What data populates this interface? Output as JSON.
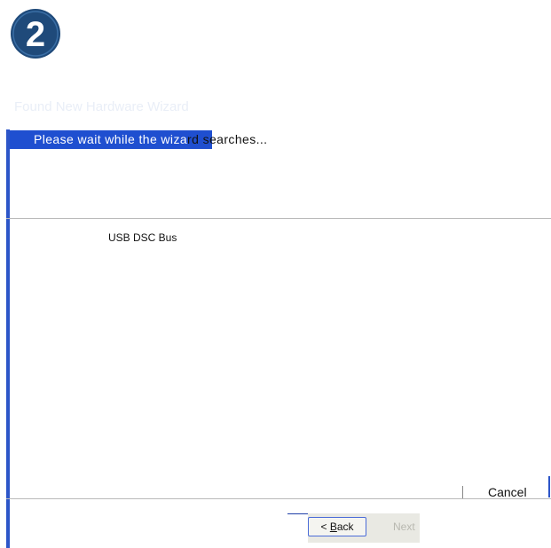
{
  "step": {
    "number": "2",
    "color": "#1f4a7a"
  },
  "wizard": {
    "title": "Found New Hardware Wizard",
    "status_highlighted": "Please wait while the wiza",
    "status_rest": "rd searches...",
    "device": "USB DSC Bus"
  },
  "buttons": {
    "cancel": "Cancel",
    "back_prefix": "< ",
    "back_underlined": "B",
    "back_rest": "ack",
    "next": "Next"
  },
  "colors": {
    "highlight": "#1f4fd0",
    "frame_accent": "#2c55c8"
  }
}
